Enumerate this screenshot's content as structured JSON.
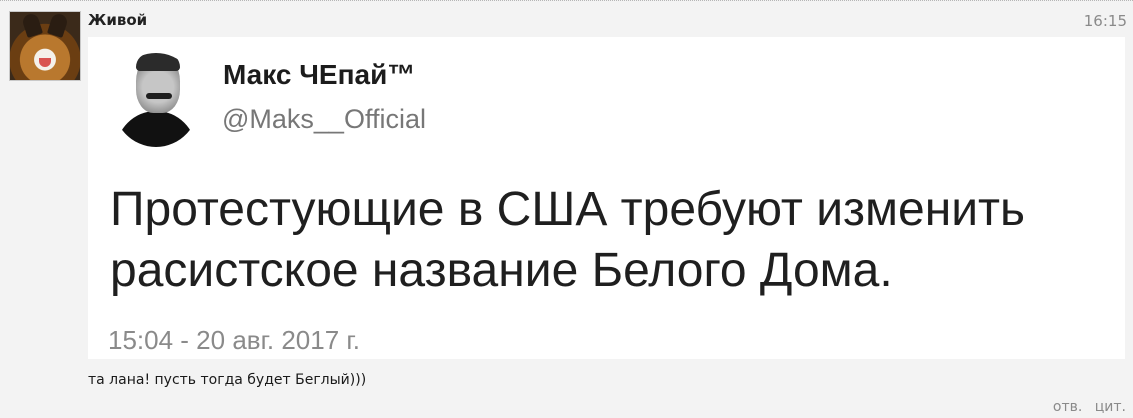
{
  "post": {
    "username": "Живой",
    "time": "16:15",
    "message": "та лана! пусть тогда будет Беглый)))",
    "actions": {
      "reply": "отв.",
      "quote": "цит."
    }
  },
  "tweet": {
    "author_name": "Макс ЧЕпай™",
    "author_handle": "@Maks__Official",
    "text_line1": "Протестующие в США требуют изменить",
    "text_line2": "расистское название Белого Дома.",
    "date": "15:04 - 20 авг. 2017 г."
  },
  "colors": {
    "page_bg": "#f3f3f3",
    "card_bg": "#ffffff",
    "muted": "#8a8a8a"
  }
}
